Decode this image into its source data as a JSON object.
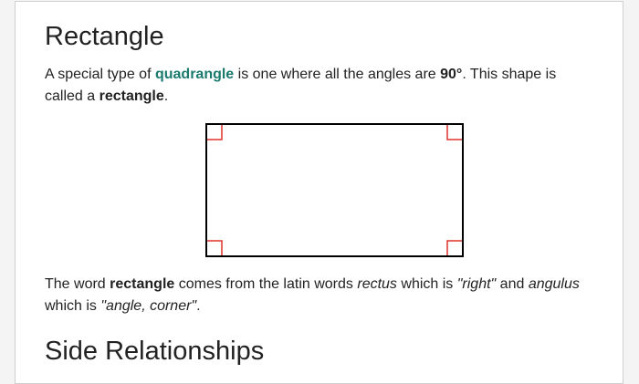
{
  "heading_1": "Rectangle",
  "intro": {
    "t1": "A special type of ",
    "link": "quadrangle",
    "t2": " is one where all the angles are ",
    "angle": "90°",
    "t3": ". This shape is called a ",
    "term": "rectangle",
    "t4": "."
  },
  "etymology": {
    "t1": "The word ",
    "term": "rectangle",
    "t2": " comes from the latin words ",
    "word1": "rectus",
    "t3": " which is ",
    "meaning1": "\"right\"",
    "t4": " and ",
    "word2": "angulus",
    "t5": " which is ",
    "meaning2": "\"angle, corner\"",
    "t6": "."
  },
  "heading_2": "Side Relationships",
  "colors": {
    "link": "#1a7a6e",
    "right_angle_marker": "#e0302a",
    "outline": "#000000"
  }
}
